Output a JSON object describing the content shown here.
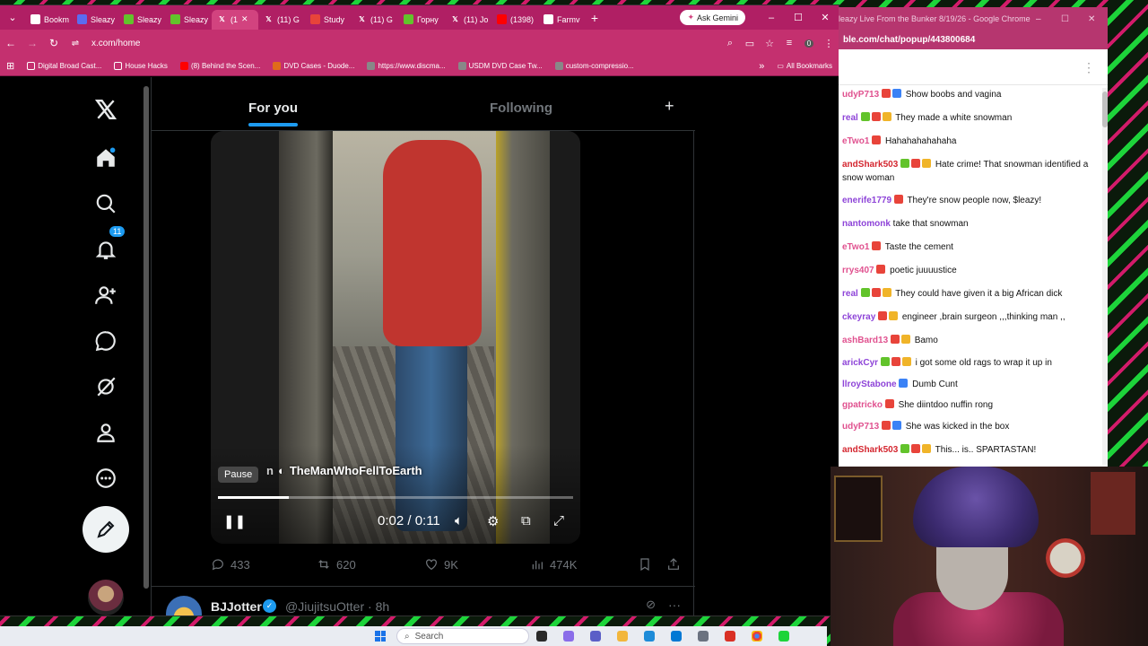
{
  "browser": {
    "tabs": [
      {
        "label": "Bookm",
        "icon": "star-icon",
        "color": "#ffffff"
      },
      {
        "label": "Sleazy",
        "icon": "rumble-icon",
        "color": "#5b6cf0"
      },
      {
        "label": "Sleazy",
        "icon": "rumble-icon",
        "color": "#62c32b"
      },
      {
        "label": "Sleazy",
        "icon": "rumble-icon",
        "color": "#62c32b"
      },
      {
        "label": "(1",
        "icon": "x-icon",
        "color": "#000000",
        "active": true
      },
      {
        "label": "(11) G",
        "icon": "x-icon",
        "color": "#000000"
      },
      {
        "label": "Study",
        "icon": "study-icon",
        "color": "#e8443a"
      },
      {
        "label": "(11) G",
        "icon": "x-icon",
        "color": "#000000"
      },
      {
        "label": "Горну",
        "icon": "rumble-icon",
        "color": "#62c32b"
      },
      {
        "label": "(11) Jo",
        "icon": "x-icon",
        "color": "#000000"
      },
      {
        "label": "(1398)",
        "icon": "youtube-icon",
        "color": "#ff0000"
      },
      {
        "label": "Farmv",
        "icon": "w-icon",
        "color": "#ffffff"
      }
    ],
    "gemini_label": "Ask Gemini",
    "url": "x.com/home",
    "bookmarks": [
      {
        "label": "Digital Broad Cast...",
        "icon": "folder-icon"
      },
      {
        "label": "House Hacks",
        "icon": "folder-icon"
      },
      {
        "label": "(8) Behind the Scen...",
        "icon": "youtube-icon"
      },
      {
        "label": "DVD Cases - Duode...",
        "icon": "dvd-icon"
      },
      {
        "label": "https://www.discma...",
        "icon": "site-icon"
      },
      {
        "label": "USDM DVD Case Tw...",
        "icon": "site-icon"
      },
      {
        "label": "custom-compressio...",
        "icon": "site-icon"
      }
    ],
    "all_bookmarks": "All Bookmarks",
    "profile_initial": "0"
  },
  "x": {
    "notifications_count": "11",
    "tabs": {
      "for_you": "For you",
      "following": "Following"
    },
    "video": {
      "watermark": "TheManWhoFellToEarth",
      "watermark_prefix": "n",
      "pause_tooltip": "Pause",
      "time": "0:02 / 0:11",
      "progress": 0.2
    },
    "actions": {
      "replies": "433",
      "reposts": "620",
      "likes": "9K",
      "views": "474K"
    },
    "next_post": {
      "name": "BJJotter",
      "handle": "@JiujitsuOtter",
      "time": "· 8h"
    }
  },
  "chat": {
    "window_title": "leazy Live From the Bunker 8/19/26 - Google Chrome",
    "url": "ble.com/chat/popup/443800684",
    "messages": [
      {
        "user": "udyP713",
        "color": "#e0518f",
        "badges": [
          "#e8443a",
          "#3b82f6"
        ],
        "text": "Show boobs and vagina"
      },
      {
        "user": "real",
        "color": "#8e44d8",
        "badges": [
          "#62c32b",
          "#e8443a",
          "#f0b429"
        ],
        "text": "They made a white snowman"
      },
      {
        "user": "eTwo1",
        "color": "#e0518f",
        "badges": [
          "#e8443a"
        ],
        "text": "Hahahahahahaha"
      },
      {
        "user": "andShark503",
        "color": "#d4262f",
        "badges": [
          "#62c32b",
          "#e8443a",
          "#f0b429"
        ],
        "text": "Hate crime! That snowman identified a snow woman"
      },
      {
        "user": "enerife1779",
        "color": "#8e44d8",
        "badges": [
          "#e8443a"
        ],
        "text": "They're snow people now, $leazy!"
      },
      {
        "user": "nantomonk",
        "color": "#8e44d8",
        "badges": [],
        "text": "take that snowman"
      },
      {
        "user": "eTwo1",
        "color": "#e0518f",
        "badges": [
          "#e8443a"
        ],
        "text": "Taste the cement"
      },
      {
        "user": "rrys407",
        "color": "#e0518f",
        "badges": [
          "#e8443a"
        ],
        "text": "poetic juuuustice"
      },
      {
        "user": "real",
        "color": "#8e44d8",
        "badges": [
          "#62c32b",
          "#e8443a",
          "#f0b429"
        ],
        "text": "They could have given it a big African dick"
      },
      {
        "user": "ckeyray",
        "color": "#8e44d8",
        "badges": [
          "#e8443a",
          "#f0b429"
        ],
        "text": "engineer ,brain surgeon ,,,thinking man ,,"
      },
      {
        "user": "ashBard13",
        "color": "#e0518f",
        "badges": [
          "#e8443a",
          "#f0b429"
        ],
        "text": "Bamo"
      },
      {
        "user": "arickCyr",
        "color": "#8e44d8",
        "badges": [
          "#62c32b",
          "#e8443a",
          "#f0b429"
        ],
        "text": "i got some old rags to wrap it up in"
      },
      {
        "user": "llroyStabone",
        "color": "#8e44d8",
        "badges": [
          "#3b82f6"
        ],
        "text": "Dumb Cunt"
      },
      {
        "user": "gpatricko",
        "color": "#e0518f",
        "badges": [
          "#e8443a"
        ],
        "text": "She diintdoo nuffin rong"
      },
      {
        "user": "udyP713",
        "color": "#e0518f",
        "badges": [
          "#e8443a",
          "#3b82f6"
        ],
        "text": "She was kicked in the box"
      },
      {
        "user": "andShark503",
        "color": "#d4262f",
        "badges": [
          "#62c32b",
          "#e8443a",
          "#f0b429"
        ],
        "text": "This... is.. SPARTASTAN!"
      }
    ]
  },
  "taskbar": {
    "search_label": "Search"
  }
}
